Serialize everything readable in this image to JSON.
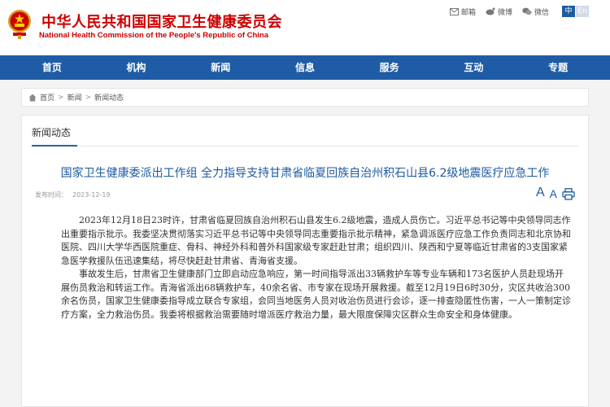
{
  "header": {
    "title": "中华人民共和国国家卫生健康委员会",
    "subtitle": "National Health Commission of the People's Republic of China",
    "tools": [
      {
        "icon": "mail-icon",
        "label": "邮箱"
      },
      {
        "icon": "weibo-icon",
        "label": "微博"
      },
      {
        "icon": "wechat-icon",
        "label": "微信"
      }
    ],
    "lang": {
      "active": "中",
      "other": "En"
    }
  },
  "nav": {
    "items": [
      "首页",
      "机构",
      "新闻",
      "信息",
      "服务",
      "互动",
      "专题"
    ]
  },
  "breadcrumb": {
    "home": "首页",
    "sep": ">",
    "level1": "新闻",
    "level2": "新闻动态"
  },
  "panel": {
    "section_title": "新闻动态"
  },
  "article": {
    "title": "国家卫生健康委派出工作组 全力指导支持甘肃省临夏回族自治州积石山县6.2级地震医疗应急工作",
    "date_label": "发布时间：",
    "date": "2023-12-19",
    "font_large": "A",
    "font_small": "A",
    "paragraphs": [
      "2023年12月18日23时许，甘肃省临夏回族自治州积石山县发生6.2级地震，造成人员伤亡。习近平总书记等中央领导同志作出重要指示批示。我委坚决贯彻落实习近平总书记等中央领导同志重要指示批示精神，紧急调派医疗应急工作负责同志和北京协和医院、四川大学华西医院重症、骨科、神经外科和普外科国家级专家赶赴甘肃；组织四川、陕西和宁夏等临近甘肃省的3支国家紧急医学救援队伍迅速集结，将尽快赶赴甘肃省、青海省支援。",
      "事故发生后，甘肃省卫生健康部门立即启动应急响应，第一时间指导派出33辆救护车等专业车辆和173名医护人员赴现场开展伤员救治和转运工作。青海省派出68辆救护车，40余名省、市专家在现场开展救援。截至12月19日6时30分，灾区共收治300余名伤员，国家卫生健康委指导成立联合专家组，会同当地医务人员对收治伤员进行会诊，逐一排查隐匿性伤害，一人一策制定诊疗方案，全力救治伤员。我委将根据救治需要随时增派医疗救治力量，最大限度保障灾区群众生命安全和身体健康。"
    ]
  },
  "colors": {
    "brand_red": "#cc0000",
    "nav_blue": "#1f5ca5",
    "title_blue": "#1d5aa0"
  }
}
